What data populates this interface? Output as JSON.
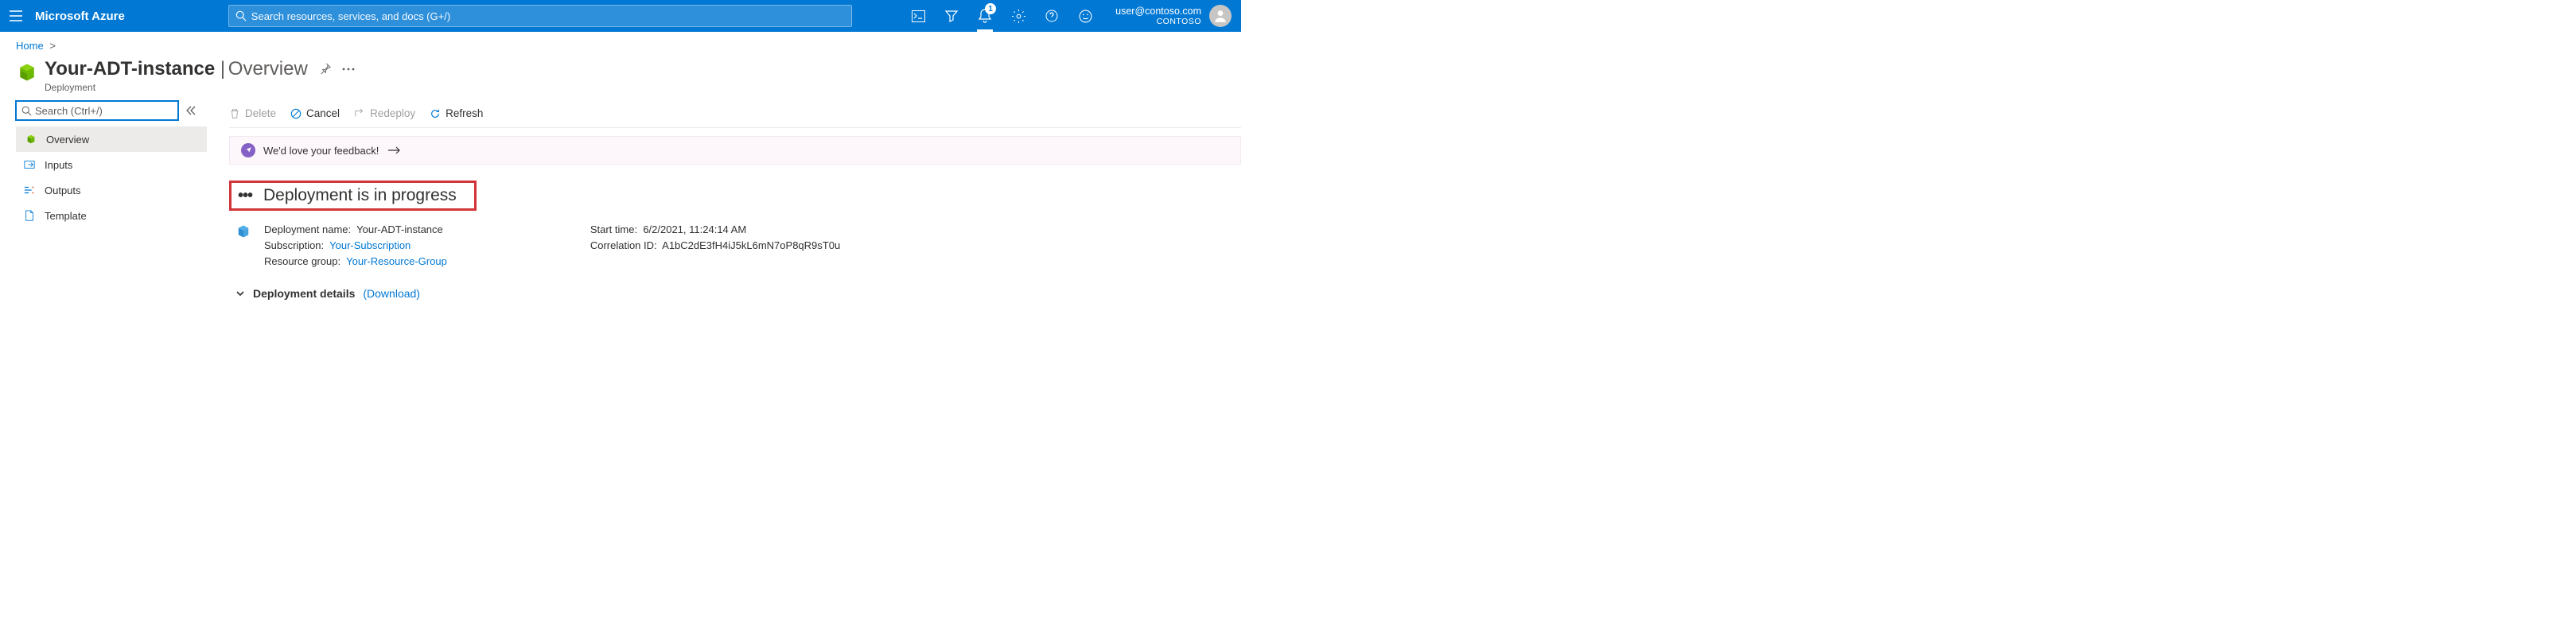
{
  "header": {
    "brand": "Microsoft Azure",
    "search_placeholder": "Search resources, services, and docs (G+/)",
    "notification_count": "1",
    "user_email": "user@contoso.com",
    "tenant": "CONTOSO"
  },
  "breadcrumb": {
    "home": "Home"
  },
  "title": {
    "resource_name": "Your-ADT-instance",
    "separator": "  |",
    "page": "Overview",
    "subtype": "Deployment"
  },
  "sidebar": {
    "search_placeholder": "Search (Ctrl+/)",
    "items": [
      {
        "label": "Overview"
      },
      {
        "label": "Inputs"
      },
      {
        "label": "Outputs"
      },
      {
        "label": "Template"
      }
    ]
  },
  "toolbar": {
    "delete": "Delete",
    "cancel": "Cancel",
    "redeploy": "Redeploy",
    "refresh": "Refresh"
  },
  "feedback": {
    "text": "We'd love your feedback!"
  },
  "status": {
    "text": "Deployment is in progress"
  },
  "deployment": {
    "name_label": "Deployment name:",
    "name_value": "Your-ADT-instance",
    "subscription_label": "Subscription:",
    "subscription_value": "Your-Subscription",
    "rg_label": "Resource group:",
    "rg_value": "Your-Resource-Group",
    "start_label": "Start time:",
    "start_value": "6/2/2021, 11:24:14 AM",
    "corr_label": "Correlation ID:",
    "corr_value": "A1bC2dE3fH4iJ5kL6mN7oP8qR9sT0u"
  },
  "dep_details": {
    "label": "Deployment details",
    "download": "(Download)"
  }
}
